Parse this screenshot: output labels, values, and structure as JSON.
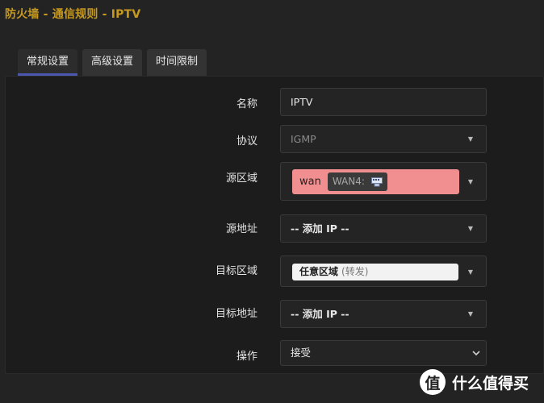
{
  "page_title": "防火墙 - 通信规则 - IPTV",
  "tabs": [
    {
      "label": "常规设置",
      "active": true
    },
    {
      "label": "高级设置",
      "active": false
    },
    {
      "label": "时间限制",
      "active": false
    }
  ],
  "form": {
    "name": {
      "label": "名称",
      "value": "IPTV"
    },
    "protocol": {
      "label": "协议",
      "value": "IGMP"
    },
    "src_zone": {
      "label": "源区域",
      "zone": "wan",
      "badge": "WAN4:",
      "zone_color": "#f08e90"
    },
    "src_addr": {
      "label": "源地址",
      "value": "-- 添加 IP --"
    },
    "dest_zone": {
      "label": "目标区域",
      "value": "任意区域",
      "note": "(转发)"
    },
    "dest_addr": {
      "label": "目标地址",
      "value": "-- 添加 IP --"
    },
    "action": {
      "label": "操作",
      "value": "接受"
    }
  },
  "watermark": {
    "text": "什么值得买",
    "logo_char": "值"
  }
}
